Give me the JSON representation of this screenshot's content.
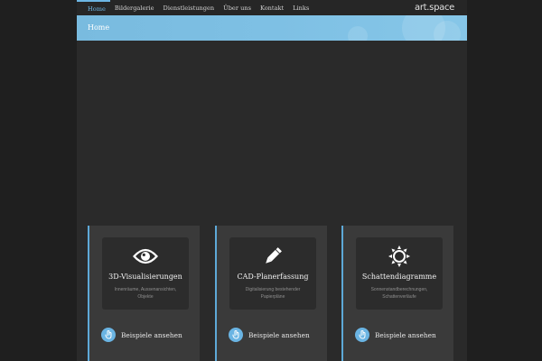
{
  "nav": {
    "items": [
      {
        "label": "Home",
        "active": true
      },
      {
        "label": "Bildergalerie",
        "active": false
      },
      {
        "label": "Dienstleistungen",
        "active": false
      },
      {
        "label": "Über uns",
        "active": false
      },
      {
        "label": "Kontakt",
        "active": false
      },
      {
        "label": "Links",
        "active": false
      }
    ],
    "logo": "art.space"
  },
  "banner": {
    "title": "Home"
  },
  "services": [
    {
      "icon": "eye-icon",
      "title": "3D-Visualisierungen",
      "desc_line1": "Innenräume, Aussenansichten,",
      "desc_line2": "Objekte",
      "cta": "Beispiele ansehen"
    },
    {
      "icon": "pencil-icon",
      "title": "CAD-Planerfassung",
      "desc_line1": "Digitalisierung bestehender",
      "desc_line2": "Papierpläne",
      "cta": "Beispiele ansehen"
    },
    {
      "icon": "sun-icon",
      "title": "Schattendiagramme",
      "desc_line1": "Sonnenstandberechnungen,",
      "desc_line2": "Schattenverläufe",
      "cta": "Beispiele ansehen"
    }
  ],
  "colors": {
    "accent": "#6db6e4",
    "background": "#1f1f1f",
    "panel": "#2a2a2a"
  }
}
